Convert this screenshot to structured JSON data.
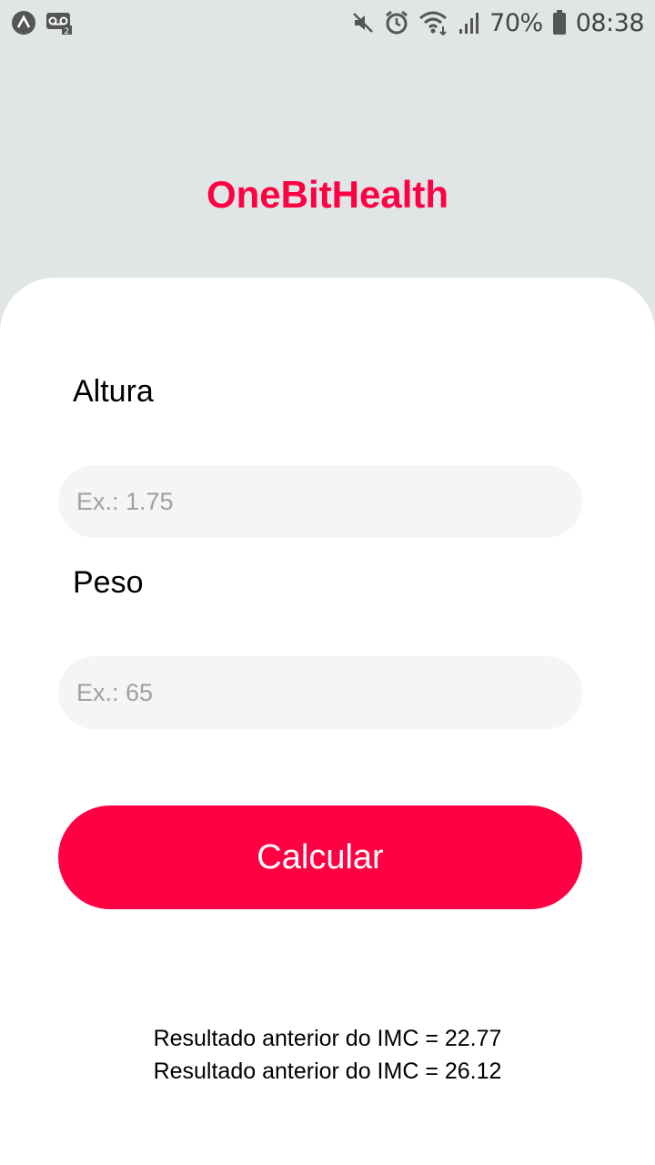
{
  "status_bar": {
    "left_icons": [
      "app-a-icon",
      "voicemail-icon"
    ],
    "right_icons": [
      "mute-icon",
      "alarm-icon",
      "wifi-icon",
      "signal-icon",
      "battery-icon"
    ],
    "battery_percent": "70%",
    "time": "08:38"
  },
  "app": {
    "title": "OneBitHealth",
    "colors": {
      "accent": "#ff0043",
      "background": "#e0e5e5",
      "card": "#ffffff",
      "field": "#f5f5f5"
    }
  },
  "form": {
    "height_label": "Altura",
    "height_placeholder": "Ex.: 1.75",
    "height_value": "",
    "weight_label": "Peso",
    "weight_placeholder": "Ex.: 65",
    "weight_value": "",
    "calculate_label": "Calcular"
  },
  "history": [
    "Resultado anterior do IMC = 22.77",
    "Resultado anterior do IMC = 26.12"
  ]
}
